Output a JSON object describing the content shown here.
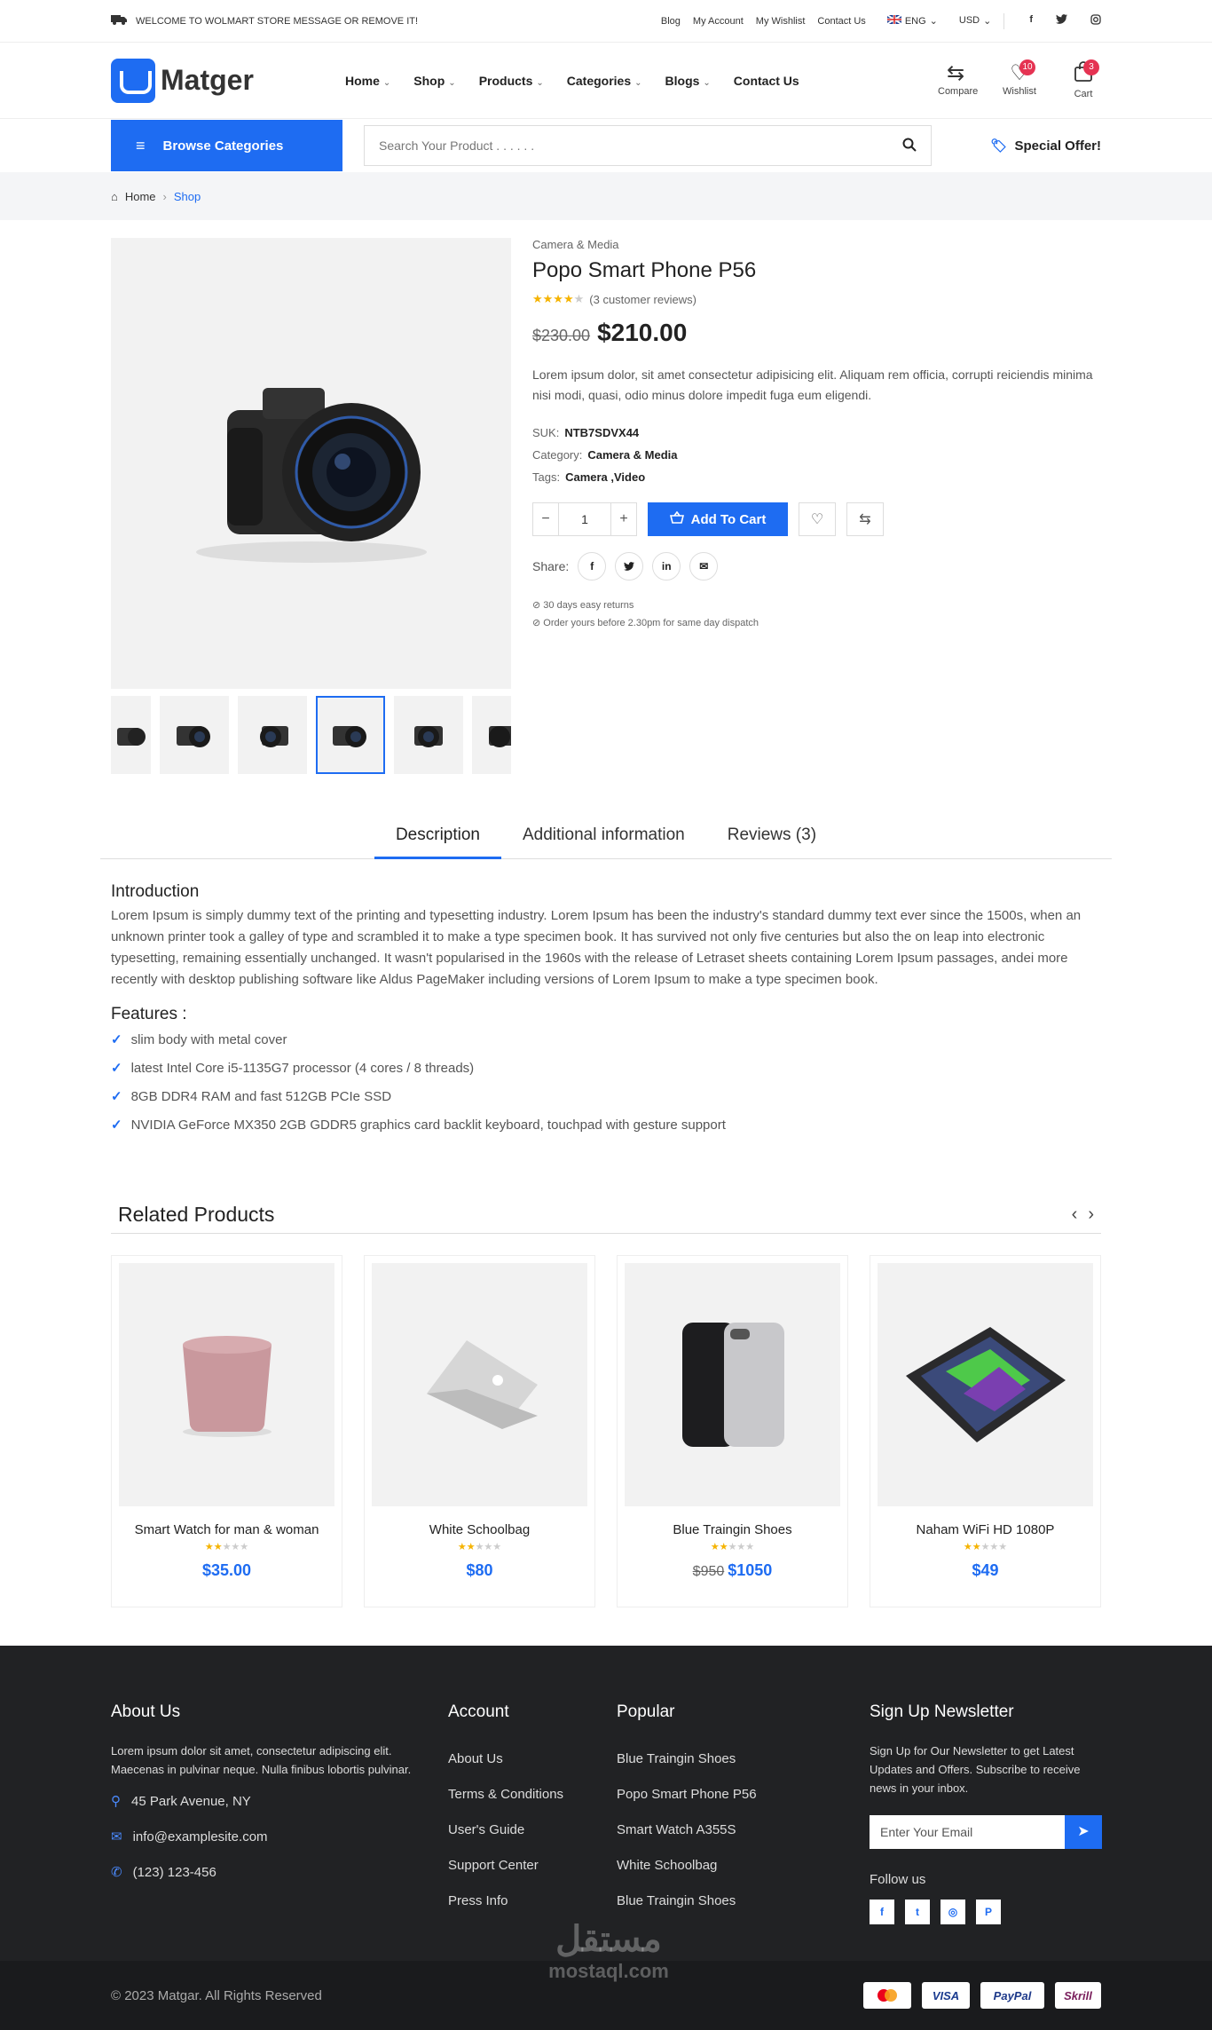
{
  "topbar": {
    "message": "WELCOME TO WOLMART STORE MESSAGE OR REMOVE IT!",
    "links": [
      "Blog",
      "My Account",
      "My Wishlist",
      "Contact Us"
    ],
    "language": "ENG",
    "currency": "USD"
  },
  "header": {
    "logo": "Matger",
    "nav": [
      "Home",
      "Shop",
      "Products",
      "Categories",
      "Blogs",
      "Contact Us"
    ],
    "compare_label": "Compare",
    "wishlist_label": "Wishlist",
    "wishlist_count": "10",
    "cart_label": "Cart",
    "cart_count": "3"
  },
  "searchrow": {
    "browse_label": "Browse Categories",
    "search_placeholder": "Search Your Product . . . . . .",
    "offer_label": "Special Offer!"
  },
  "breadcrumb": {
    "home": "Home",
    "current": "Shop"
  },
  "product": {
    "category": "Camera & Media",
    "title": "Popo Smart Phone P56",
    "rating": 4,
    "reviews_text": "(3 customer reviews)",
    "old_price": "$230.00",
    "price": "$210.00",
    "description": "Lorem ipsum dolor, sit amet consectetur adipisicing elit. Aliquam rem officia, corrupti reiciendis minima nisi modi, quasi, odio minus dolore impedit fuga eum eligendi.",
    "sku_label": "SUK:",
    "sku": "NTB7SDVX44",
    "category_label": "Category:",
    "category_value": "Camera & Media",
    "tags_label": "Tags:",
    "tags_value": "Camera ,Video",
    "quantity": "1",
    "add_to_cart": "Add To Cart",
    "share_label": "Share:",
    "note1": "30 days easy returns",
    "note2": "Order yours before 2.30pm for same day dispatch"
  },
  "tabs": [
    "Description",
    "Additional information",
    "Reviews (3)"
  ],
  "description": {
    "intro_title": "Introduction",
    "intro_text": "Lorem Ipsum is simply dummy text of the printing and typesetting industry. Lorem Ipsum has been the industry's standard dummy text ever since the 1500s, when an unknown printer took a galley of type and scrambled it to make a type specimen book. It has survived not only five centuries but also the on leap into electronic typesetting, remaining essentially unchanged. It wasn't popularised in the 1960s with the release of Letraset sheets containing Lorem Ipsum passages, andei more recently with desktop publishing software like Aldus PageMaker including versions of Lorem Ipsum to make a type specimen book.",
    "features_title": "Features :",
    "features": [
      "slim body with metal cover",
      "latest Intel Core i5-1135G7 processor (4 cores / 8 threads)",
      "8GB DDR4 RAM and fast 512GB PCIe SSD",
      "NVIDIA GeForce MX350 2GB GDDR5 graphics card backlit keyboard, touchpad with gesture support"
    ]
  },
  "related": {
    "title": "Related Products",
    "items": [
      {
        "name": "Smart Watch for man & woman",
        "rating": 2,
        "old_price": "",
        "price": "$35.00"
      },
      {
        "name": "White Schoolbag",
        "rating": 2,
        "old_price": "",
        "price": "$80"
      },
      {
        "name": "Blue Traingin Shoes",
        "rating": 2,
        "old_price": "$950",
        "price": "$1050"
      },
      {
        "name": "Naham WiFi HD 1080P",
        "rating": 2,
        "old_price": "",
        "price": "$49"
      }
    ]
  },
  "footer": {
    "about_title": "About Us",
    "about_text": "Lorem ipsum dolor sit amet, consectetur adipiscing elit. Maecenas in pulvinar neque. Nulla finibus lobortis pulvinar.",
    "address": "45 Park Avenue, NY",
    "email": "info@examplesite.com",
    "phone": "(123) 123-456",
    "account_title": "Account",
    "account_links": [
      "About Us",
      "Terms & Conditions",
      "User's Guide",
      "Support Center",
      "Press Info"
    ],
    "popular_title": "Popular",
    "popular_links": [
      "Blue Traingin Shoes",
      "Popo Smart Phone P56",
      "Smart Watch A355S",
      "White Schoolbag",
      "Blue Traingin Shoes"
    ],
    "newsletter_title": "Sign Up Newsletter",
    "newsletter_text": "Sign Up for Our Newsletter to get Latest Updates and Offers. Subscribe to receive news in your inbox.",
    "email_placeholder": "Enter Your Email",
    "follow_label": "Follow us",
    "copyright": "© 2023 Matgar. All Rights Reserved",
    "payments": [
      "VISA",
      "PayPal",
      "Skrill"
    ]
  },
  "watermark": {
    "arabic": "مستقل",
    "latin": "mostaql.com"
  },
  "colors": {
    "accent": "#1e6cf2",
    "badge": "#e53352",
    "footer_bg": "#212224",
    "star": "#f5b301"
  }
}
